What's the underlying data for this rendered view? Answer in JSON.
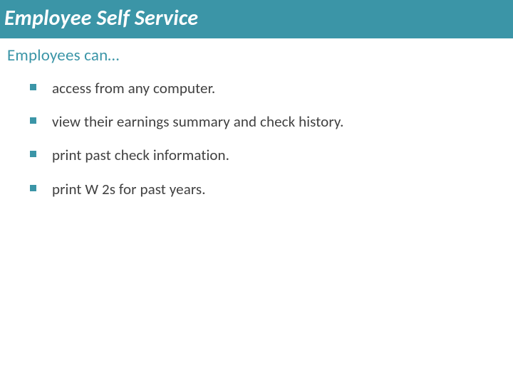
{
  "header": {
    "title": "Employee Self Service"
  },
  "subheading": "Employees can…",
  "bullets": {
    "b0": "access from any computer.",
    "b1": "view their earnings summary and check history.",
    "b2": "print past check information.",
    "b3": "print W 2s for past years."
  }
}
